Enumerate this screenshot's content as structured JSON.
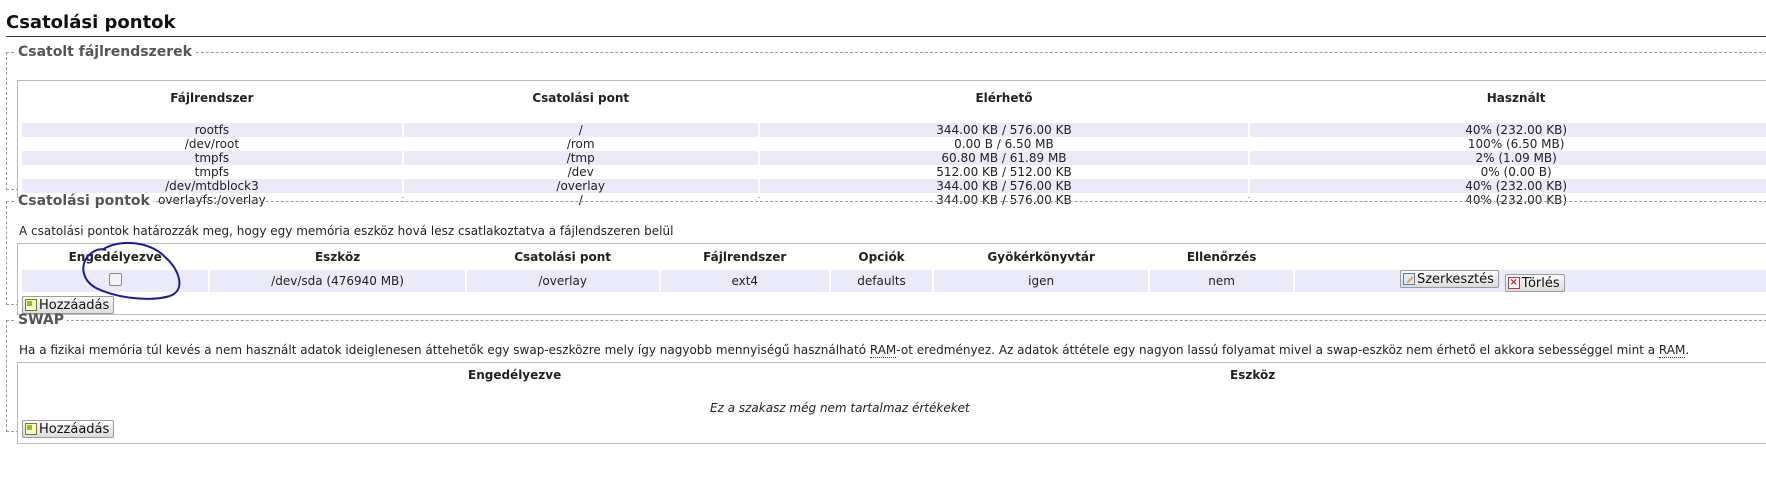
{
  "page": {
    "title": "Csatolási pontok"
  },
  "mounted": {
    "legend": "Csatolt fájlrendszerek",
    "headers": [
      "Fájlrendszer",
      "Csatolási pont",
      "Elérhető",
      "Használt"
    ],
    "rows": [
      [
        "rootfs",
        "/",
        "344.00 KB / 576.00 KB",
        "40% (232.00 KB)"
      ],
      [
        "/dev/root",
        "/rom",
        "0.00 B / 6.50 MB",
        "100% (6.50 MB)"
      ],
      [
        "tmpfs",
        "/tmp",
        "60.80 MB / 61.89 MB",
        "2% (1.09 MB)"
      ],
      [
        "tmpfs",
        "/dev",
        "512.00 KB / 512.00 KB",
        "0% (0.00 B)"
      ],
      [
        "/dev/mtdblock3",
        "/overlay",
        "344.00 KB / 576.00 KB",
        "40% (232.00 KB)"
      ],
      [
        "overlayfs:/overlay",
        "/",
        "344.00 KB / 576.00 KB",
        "40% (232.00 KB)"
      ]
    ]
  },
  "mounts": {
    "legend": "Csatolási pontok",
    "description": "A csatolási pontok határozzák meg, hogy egy memória eszköz hová lesz csatlakoztatva a fájlendszeren belül",
    "headers": [
      "Engedélyezve",
      "Eszköz",
      "Csatolási pont",
      "Fájlrendszer",
      "Opciók",
      "Gyökérkönyvtár",
      "Ellenőrzés"
    ],
    "row": {
      "enabled": false,
      "device": "/dev/sda (476940 MB)",
      "mount_point": "/overlay",
      "filesystem": "ext4",
      "options": "defaults",
      "root": "igen",
      "check": "nem"
    },
    "edit_label": "Szerkesztés",
    "delete_label": "Törlés",
    "add_label": "Hozzáadás"
  },
  "swap": {
    "legend": "SWAP",
    "description_pre": "Ha a fizikai memória túl kevés a nem használt adatok ideiglenesen áttehetők egy swap-eszközre mely így nagyobb mennyiségű használható ",
    "abbr1": "RAM",
    "description_mid": "-ot eredményez. Az adatok áttétele egy nagyon lassú folyamat mivel a swap-eszköz nem érhető el akkora sebességgel mint a ",
    "abbr2": "RAM",
    "description_post": ".",
    "headers": [
      "Engedélyezve",
      "Eszköz"
    ],
    "empty_message": "Ez a szakasz még nem tartalmaz értékeket",
    "add_label": "Hozzáadás"
  },
  "annotation": {
    "color": "#1a1aa0"
  }
}
